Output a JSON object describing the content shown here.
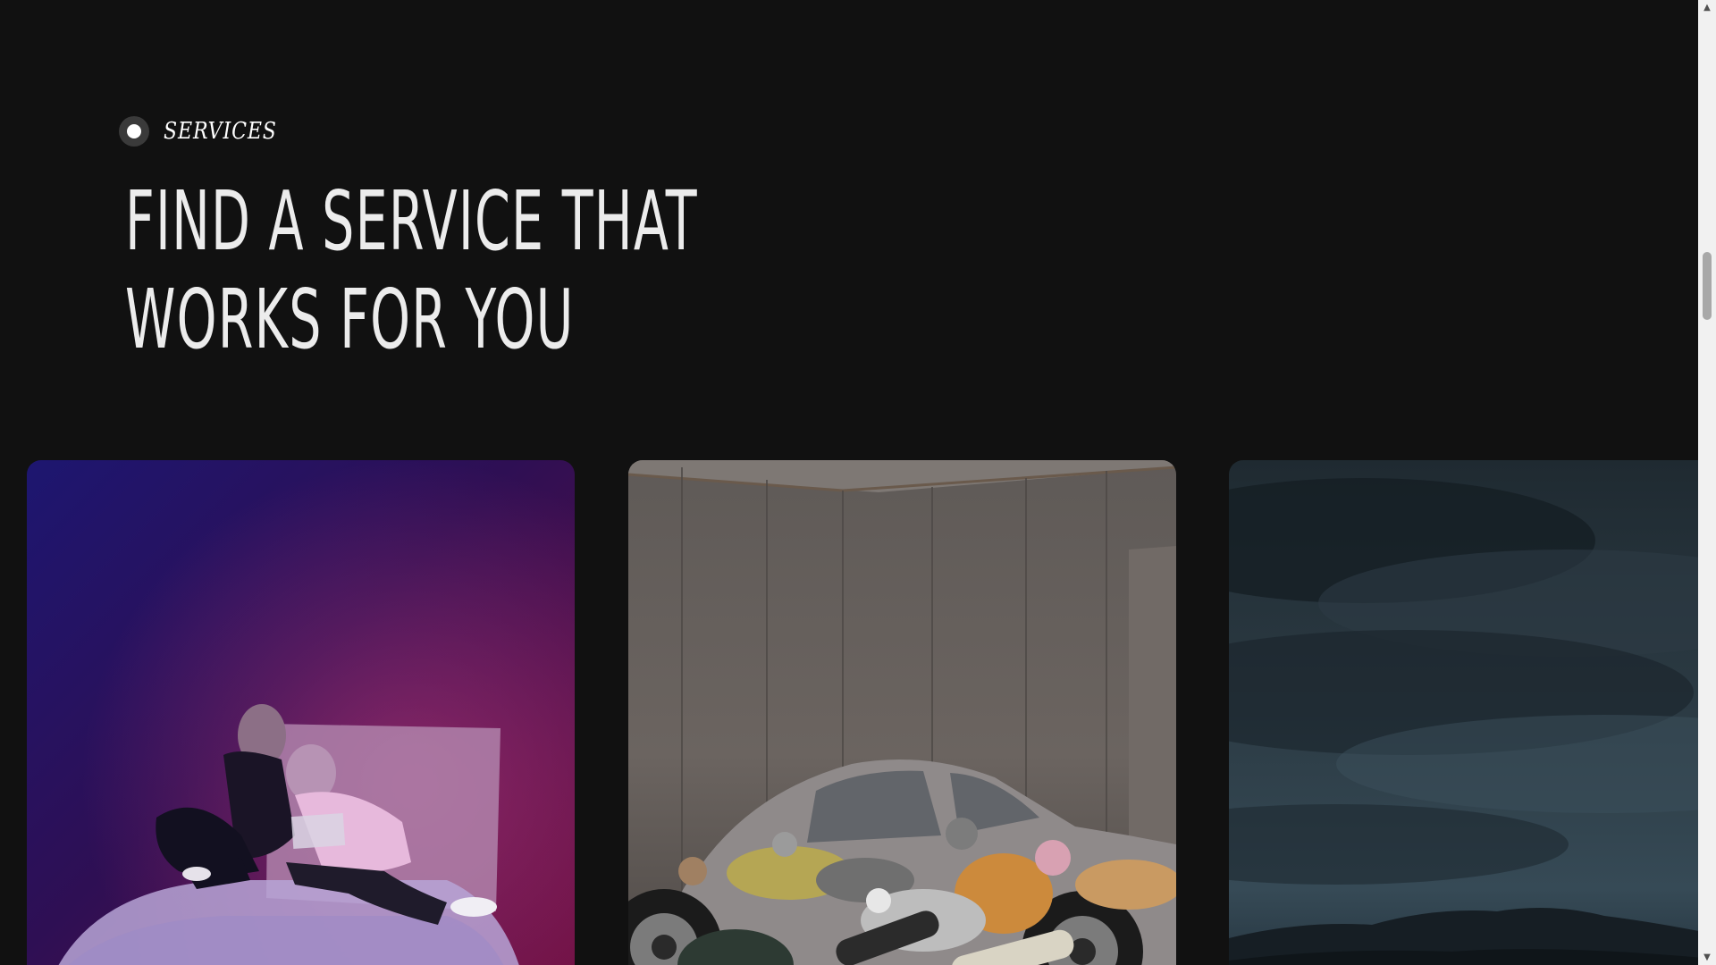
{
  "section": {
    "eyebrow_label": "SERVICES",
    "heading_line_1": "FIND A SERVICE THAT",
    "heading_line_2": "WORKS FOR YOU"
  },
  "cards": [
    {
      "image": "two figures resting on a bed under purple-pink light"
    },
    {
      "image": "group of figures piled around a silver vintage sports car in a grey room"
    },
    {
      "image": "cloudy sky over a dark mountain ridge"
    }
  ],
  "scrollbar": {
    "up_icon": "▲",
    "down_icon": "▼"
  },
  "colors": {
    "background": "#111111",
    "text": "#ececec",
    "card1_start": "#1d1670",
    "card1_end": "#6a0d3e",
    "scrollbar_track": "#f1f1f1",
    "scrollbar_thumb": "#a8a8a8"
  }
}
